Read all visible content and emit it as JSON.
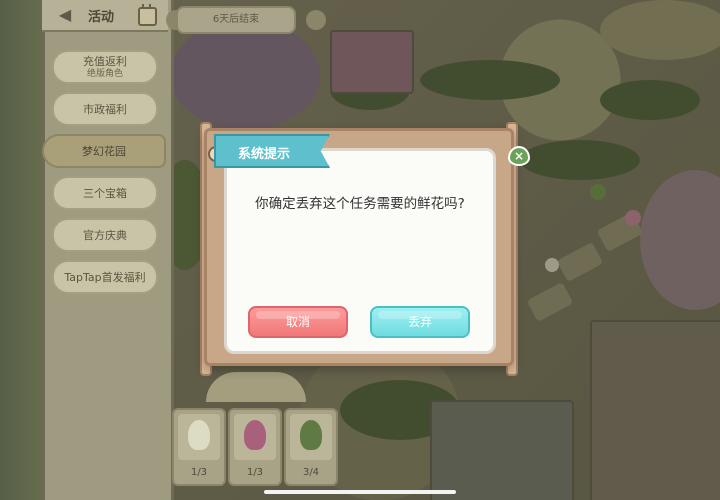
{
  "header": {
    "title": "活动",
    "back_icon": "arrow-left-icon",
    "calendar_icon": "calendar-icon"
  },
  "banner": {
    "text": "6天后结束"
  },
  "menu": {
    "items": [
      {
        "label": "充值返利",
        "sub": "绝版角色",
        "active": false
      },
      {
        "label": "市政福利",
        "sub": "",
        "active": false
      },
      {
        "label": "梦幻花园",
        "sub": "",
        "active": true
      },
      {
        "label": "三个宝箱",
        "sub": "",
        "active": false
      },
      {
        "label": "官方庆典",
        "sub": "",
        "active": false
      },
      {
        "label": "TapTap首发福利",
        "sub": "",
        "active": false
      }
    ]
  },
  "items": [
    {
      "count": "1/3",
      "icon": "white-flower-icon",
      "color": "#dcdcc4"
    },
    {
      "count": "1/3",
      "icon": "pink-flower-icon",
      "color": "#a8607c"
    },
    {
      "count": "3/4",
      "icon": "green-plant-icon",
      "color": "#5f7a42"
    }
  ],
  "dialog": {
    "title": "系统提示",
    "message": "你确定丢弃这个任务需要的鲜花吗?",
    "cancel_label": "取消",
    "confirm_label": "丢弃",
    "close_icon": "close-icon",
    "colors": {
      "title_bg": "#5ec0cc",
      "cancel": "#f07878",
      "confirm": "#6fdce0"
    }
  }
}
